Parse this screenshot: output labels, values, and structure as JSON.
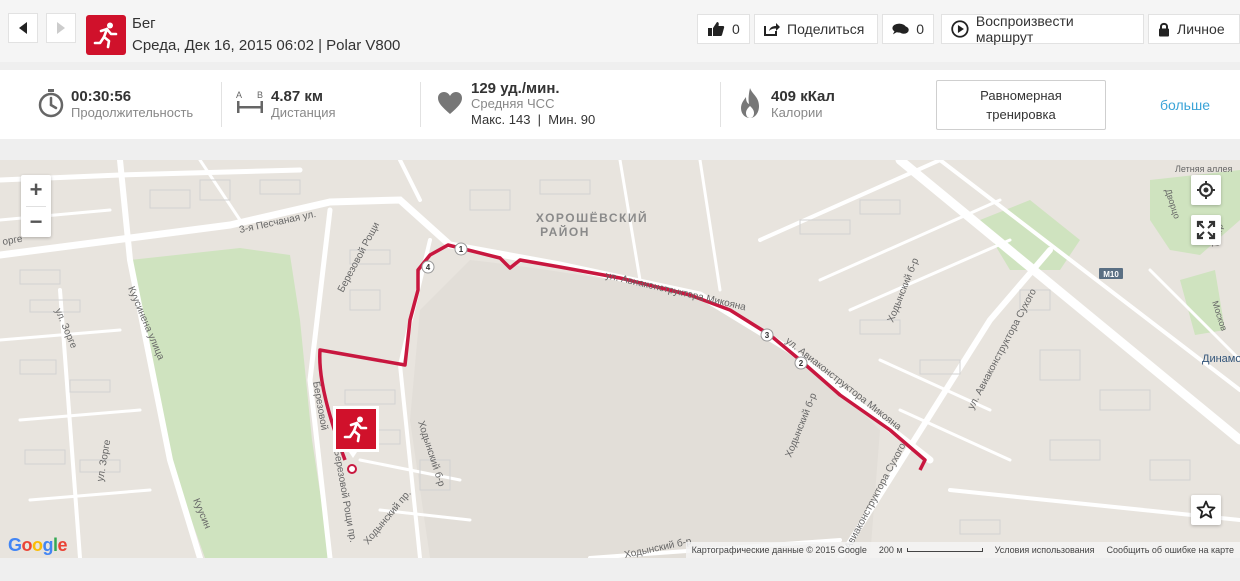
{
  "header": {
    "sport": "Бег",
    "subtitle": "Среда, Дек 16, 2015 06:02 | Polar V800",
    "like_count": "0",
    "share_label": "Поделиться",
    "comment_count": "0",
    "replay_label": "Воспроизвести маршрут",
    "privacy_label": "Личное"
  },
  "summary": {
    "duration": {
      "value": "00:30:56",
      "label": "Продолжительность"
    },
    "distance": {
      "value": "4.87 км",
      "label": "Дистанция",
      "icon_a": "A",
      "icon_b": "B"
    },
    "heart_rate": {
      "value": "129 уд./мин.",
      "label": "Средняя ЧСС",
      "detail": "Макс. 143  |  Мин. 90"
    },
    "calories": {
      "value": "409 кКал",
      "label": "Калории"
    },
    "training_label": "Равномерная тренировка",
    "more_label": "больше"
  },
  "map": {
    "zoom_in": "+",
    "zoom_out": "−",
    "route_color": "#c8173f",
    "district_1": "ХОРОШЁВСКИЙ",
    "district_2": "РАЙОН",
    "streets": {
      "pesch": "3-я Песчаная ул.",
      "berez_top": "Березовой Рощи",
      "berez_side": "Березовой",
      "avia1": "ул. Авиаконструктора Микояна",
      "avia2": "ул. Авиаконструктора Микояна",
      "sukhoi1": "ул. Авиаконструктора Сухого",
      "sukhoi2": "Авиаконструктора Сухого",
      "khod1": "Ходынский б-р",
      "khod2": "Ходынский б-р",
      "khod3": "Ходынский б-р",
      "khod_pr": "Ходынский пр.",
      "khod_bottom": "Ходынский б-р",
      "kusinena": "Куусинена улица",
      "kusinena2": "Куусин",
      "zorge1": "ул. Зорге",
      "zorge2": "ул. Зорге",
      "zorge3": "орге",
      "berez_bottom": "Березовой Рощи пр.",
      "letnyaya": "Летняя аллея",
      "dvorets": "Дворцо",
      "teatr": "Театр",
      "moskov": "Москов",
      "dinamo": "Динамо",
      "m10": "M10"
    },
    "km_markers": [
      "1",
      "2",
      "3",
      "4"
    ],
    "google": "Google",
    "attribution": {
      "data": "Картографические данные © 2015 Google",
      "scale": "200 м",
      "terms": "Условия использования",
      "report": "Сообщить об ошибке на карте"
    }
  }
}
